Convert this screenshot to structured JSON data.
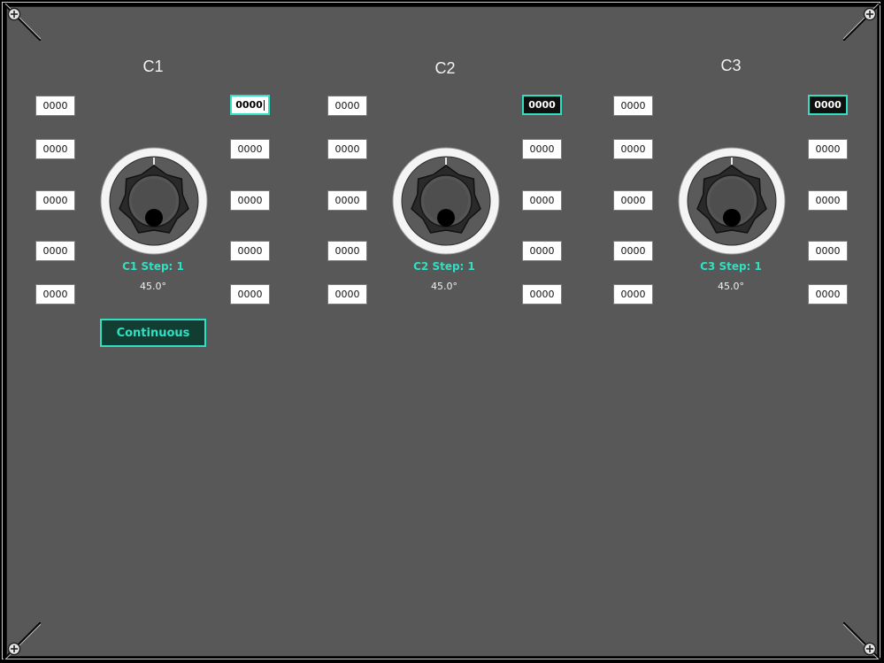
{
  "channels": [
    {
      "title": "C1",
      "step_label": "C1 Step: 1",
      "angle": "45.0°",
      "angle_deg": 45,
      "left_fields": [
        "0000",
        "0000",
        "0000",
        "0000",
        "0000"
      ],
      "right_fields": [
        "0000",
        "0000",
        "0000",
        "0000",
        "0000"
      ]
    },
    {
      "title": "C2",
      "step_label": "C2 Step: 1",
      "angle": "45.0°",
      "angle_deg": 45,
      "left_fields": [
        "0000",
        "0000",
        "0000",
        "0000",
        "0000"
      ],
      "right_fields": [
        "0000",
        "0000",
        "0000",
        "0000",
        "0000"
      ]
    },
    {
      "title": "C3",
      "step_label": "C3 Step: 1",
      "angle": "45.0°",
      "angle_deg": 45,
      "left_fields": [
        "0000",
        "0000",
        "0000",
        "0000",
        "0000"
      ],
      "right_fields": [
        "0000",
        "0000",
        "0000",
        "0000",
        "0000"
      ]
    }
  ],
  "mode_button": "Continuous",
  "colors": {
    "panel": "#585858",
    "accent": "#2fe0c2",
    "field_bg": "#ffffff",
    "active_field_bg": "#0f0f0f"
  }
}
